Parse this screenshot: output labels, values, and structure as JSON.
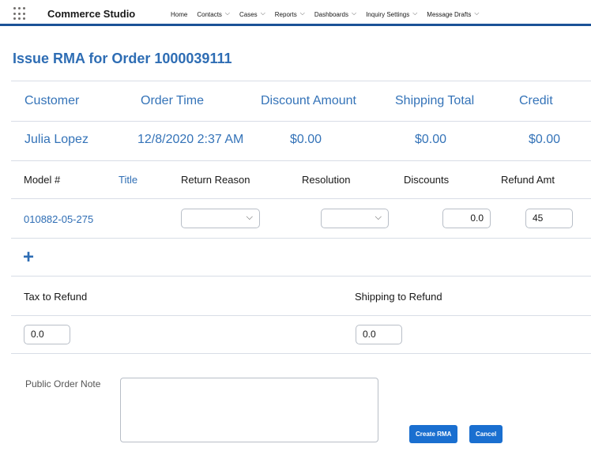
{
  "topnav": {
    "app_name": "Commerce Studio",
    "items": [
      {
        "label": "Home",
        "has_menu": false
      },
      {
        "label": "Contacts",
        "has_menu": true
      },
      {
        "label": "Cases",
        "has_menu": true
      },
      {
        "label": "Reports",
        "has_menu": true
      },
      {
        "label": "Dashboards",
        "has_menu": true
      },
      {
        "label": "Inquiry Settings",
        "has_menu": true
      },
      {
        "label": "Message Drafts",
        "has_menu": true
      }
    ],
    "chevron": "⌵"
  },
  "page": {
    "title": "Issue RMA for Order 1000039111"
  },
  "summary": {
    "headers": [
      "Customer",
      "Order Time",
      "Discount Amount",
      "Shipping Total",
      "Credit"
    ],
    "values": [
      "Julia Lopez",
      "12/8/2020 2:37 AM",
      "$0.00",
      "$0.00",
      "$0.00"
    ]
  },
  "items": {
    "headers": [
      "Model #",
      "Title",
      "Return Reason",
      "Resolution",
      "Discounts",
      "Refund Amt"
    ],
    "rows": [
      {
        "model": "010882-05-275",
        "title": "",
        "return_reason": "",
        "resolution": "",
        "discounts": "0.0",
        "refund_amt": "45"
      }
    ],
    "add_label": "+"
  },
  "refund": {
    "tax_label": "Tax to Refund",
    "tax_value": "0.0",
    "shipping_label": "Shipping to Refund",
    "shipping_value": "0.0"
  },
  "note": {
    "label": "Public Order Note",
    "value": ""
  },
  "actions": {
    "create_label": "Create RMA",
    "cancel_label": "Cancel"
  },
  "colors": {
    "accent": "#2e6db4",
    "nav_border": "#1b5297",
    "button": "#1a6fd0"
  }
}
